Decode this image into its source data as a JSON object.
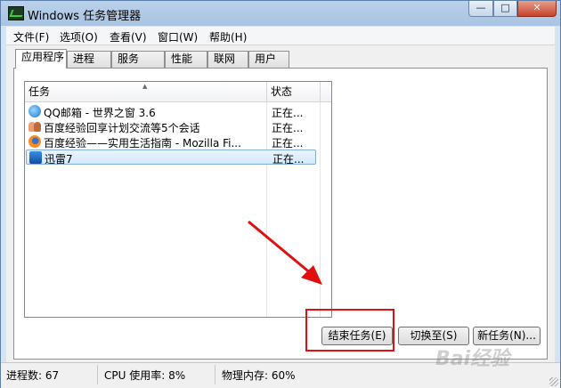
{
  "window": {
    "title": "Windows 任务管理器"
  },
  "controls": {
    "minimize": "—",
    "maximize": "□",
    "close": "✕"
  },
  "menu": [
    "文件(F)",
    "选项(O)",
    "查看(V)",
    "窗口(W)",
    "帮助(H)"
  ],
  "tabs": [
    "应用程序",
    "进程",
    "服务",
    "性能",
    "联网",
    "用户"
  ],
  "active_tab": "应用程序",
  "list": {
    "columns": [
      "任务",
      "状态"
    ],
    "rows": [
      {
        "task": "QQ邮箱 - 世界之窗 3.6",
        "status": "正在...",
        "icon": "qq-browser-icon"
      },
      {
        "task": "百度经验回享计划交流等5个会话",
        "status": "正在...",
        "icon": "qq-chat-icon"
      },
      {
        "task": "百度经验——实用生活指南 - Mozilla Fi...",
        "status": "正在...",
        "icon": "firefox-icon"
      },
      {
        "task": "迅雷7",
        "status": "正在...",
        "icon": "thunder-icon"
      }
    ],
    "selected_index": 3
  },
  "buttons": {
    "end_task": "结束任务(E)",
    "switch_to": "切换至(S)",
    "new_task": "新任务(N)..."
  },
  "status_bar": {
    "processes": "进程数: 67",
    "cpu": "CPU 使用率: 8%",
    "memory": "物理内存: 60%"
  },
  "watermark": "Bai经验",
  "colors": {
    "annotation_red": "#e01010",
    "selection_border": "#84acdd"
  }
}
